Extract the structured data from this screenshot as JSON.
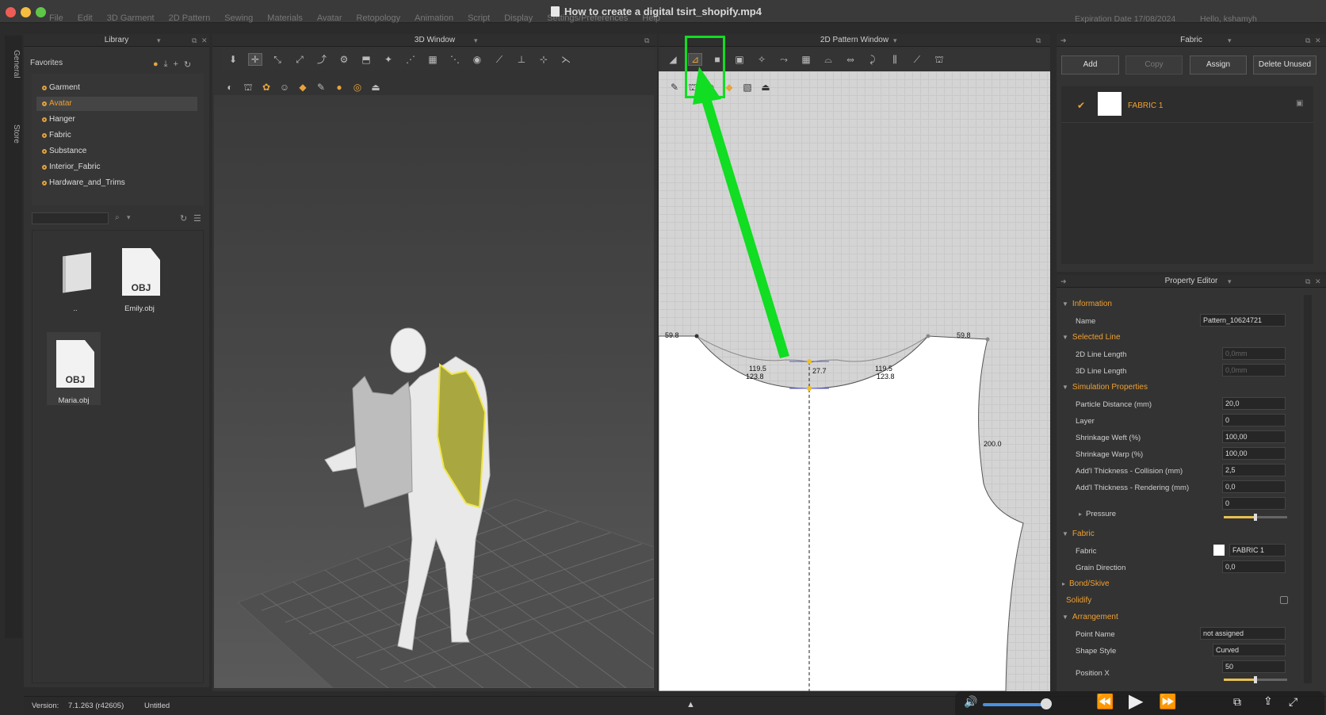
{
  "window": {
    "title": "How to create a digital tsirt_shopify.mp4",
    "expiration": "Expiration Date 17/08/2024",
    "greeting": "Hello, kshamyh"
  },
  "menu": [
    "File",
    "Edit",
    "3D Garment",
    "2D Pattern",
    "Sewing",
    "Materials",
    "Avatar",
    "Retopology",
    "Animation",
    "Script",
    "Display",
    "Settings/Preferences",
    "Help"
  ],
  "side_tabs": [
    "General",
    "Store"
  ],
  "library": {
    "title": "Library",
    "favorites_label": "Favorites",
    "items": [
      "Garment",
      "Avatar",
      "Hanger",
      "Fabric",
      "Substance",
      "Interior_Fabric",
      "Hardware_and_Trims"
    ],
    "selected": "Avatar",
    "files": [
      {
        "name": "..",
        "type": "folder"
      },
      {
        "name": "Emily.obj",
        "type": "OBJ"
      },
      {
        "name": "Maria.obj",
        "type": "OBJ"
      }
    ]
  },
  "window3d": {
    "title": "3D Window"
  },
  "window2d": {
    "title": "2D Pattern Window",
    "measurements": [
      "59.8",
      "119.5",
      "123.8",
      "27.7",
      "119.5",
      "123.8",
      "59.8",
      "200.0"
    ]
  },
  "fabric": {
    "title": "Fabric",
    "buttons": [
      "Add",
      "Copy",
      "Assign",
      "Delete Unused"
    ],
    "list": [
      {
        "name": "FABRIC 1",
        "checked": true
      }
    ]
  },
  "property_editor": {
    "title": "Property Editor",
    "sections": {
      "information": "Information",
      "selected_line": "Selected Line",
      "simulation": "Simulation Properties",
      "fabric": "Fabric",
      "bond": "Bond/Skive",
      "solidify": "Solidify",
      "arrangement": "Arrangement"
    },
    "rows": {
      "name": {
        "label": "Name",
        "value": "Pattern_10624721"
      },
      "line2d": {
        "label": "2D Line Length",
        "value": "0,0mm"
      },
      "line3d": {
        "label": "3D Line Length",
        "value": "0,0mm"
      },
      "particle": {
        "label": "Particle Distance (mm)",
        "value": "20,0"
      },
      "layer": {
        "label": "Layer",
        "value": "0"
      },
      "weft": {
        "label": "Shrinkage Weft (%)",
        "value": "100,00"
      },
      "warp": {
        "label": "Shrinkage Warp (%)",
        "value": "100,00"
      },
      "collision": {
        "label": "Add'l Thickness - Collision (mm)",
        "value": "2,5"
      },
      "rendering": {
        "label": "Add'l Thickness - Rendering (mm)",
        "value": "0,0"
      },
      "pressure": {
        "label": "Pressure",
        "value": "0"
      },
      "fabric": {
        "label": "Fabric",
        "value": "FABRIC 1"
      },
      "grain": {
        "label": "Grain Direction",
        "value": "0,0"
      },
      "point_name": {
        "label": "Point Name",
        "value": "not assigned"
      },
      "shape_style": {
        "label": "Shape Style",
        "value": "Curved"
      },
      "position_x": {
        "label": "Position X",
        "value": "50"
      }
    },
    "pressure_level": 0.5,
    "position_x_level": 0.5
  },
  "status": {
    "version_label": "Version:",
    "version": "7.1.263 (r42605)",
    "file": "Untitled"
  },
  "colors": {
    "accent": "#f0a030",
    "highlight": "#11dd22"
  }
}
